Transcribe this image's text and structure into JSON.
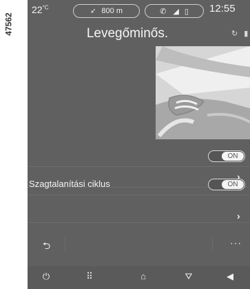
{
  "side_id": "47562",
  "status": {
    "temperature": "22",
    "temperature_unit": "°C",
    "nav_distance": "800 m",
    "time": "12:55"
  },
  "title": "Levegőminős.",
  "rows": [
    {
      "label": "",
      "control": "toggle",
      "value": "ON"
    },
    {
      "label": "",
      "control": "chevron",
      "value": ""
    },
    {
      "label": "Szagtalanítási ciklus",
      "control": "toggle",
      "value": "ON"
    },
    {
      "label": "",
      "control": "chevron",
      "value": ""
    }
  ],
  "colors": {
    "screen_bg": "#606060",
    "toggle_knob": "#f4f4f4"
  },
  "icons": {
    "back": "back-arrow-icon",
    "more": "more-dots-icon",
    "power": "power-icon",
    "apps": "apps-grid-icon",
    "home": "home-icon",
    "nav": "navigation-icon",
    "volume": "volume-icon"
  }
}
